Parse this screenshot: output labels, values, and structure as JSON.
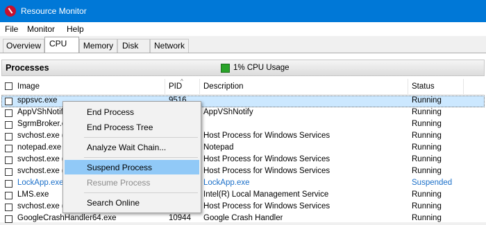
{
  "window": {
    "title": "Resource Monitor"
  },
  "menu": [
    "File",
    "Monitor",
    "Help"
  ],
  "tabs": [
    "Overview",
    "CPU",
    "Memory",
    "Disk",
    "Network"
  ],
  "processes": {
    "title": "Processes",
    "cpu_usage": "1% CPU Usage",
    "columns": {
      "image": "Image",
      "pid": "PID",
      "description": "Description",
      "status": "Status"
    },
    "rows": [
      {
        "image": "sppsvc.exe",
        "pid": "9516",
        "description": "",
        "status": "Running"
      },
      {
        "image": "AppVShNotify",
        "pid": "",
        "description": "AppVShNotify",
        "status": "Running"
      },
      {
        "image": "SgrmBroker.e",
        "pid": "",
        "description": "",
        "status": "Running"
      },
      {
        "image": "svchost.exe (",
        "pid": "",
        "description": "Host Process for Windows Services",
        "status": "Running"
      },
      {
        "image": "notepad.exe",
        "pid": "",
        "description": "Notepad",
        "status": "Running"
      },
      {
        "image": "svchost.exe (",
        "pid": "",
        "description": "Host Process for Windows Services",
        "status": "Running"
      },
      {
        "image": "svchost.exe (",
        "pid": "",
        "description": "Host Process for Windows Services",
        "status": "Running"
      },
      {
        "image": "LockApp.exe",
        "pid": "",
        "description": "LockApp.exe",
        "status": "Suspended"
      },
      {
        "image": "LMS.exe",
        "pid": "",
        "description": "Intel(R) Local Management Service",
        "status": "Running"
      },
      {
        "image": "svchost.exe (",
        "pid": "",
        "description": "Host Process for Windows Services",
        "status": "Running"
      },
      {
        "image": "GoogleCrashHandler64.exe",
        "pid": "10944",
        "description": "Google Crash Handler",
        "status": "Running"
      }
    ]
  },
  "context_menu": {
    "end_process": "End Process",
    "end_process_tree": "End Process Tree",
    "analyze_wait_chain": "Analyze Wait Chain...",
    "suspend_process": "Suspend Process",
    "resume_process": "Resume Process",
    "search_online": "Search Online"
  },
  "colors": {
    "titlebar": "#0078d7",
    "suspended_text": "#1a6fc9",
    "highlight": "#91c9f7",
    "selected_row": "#cce8ff"
  }
}
